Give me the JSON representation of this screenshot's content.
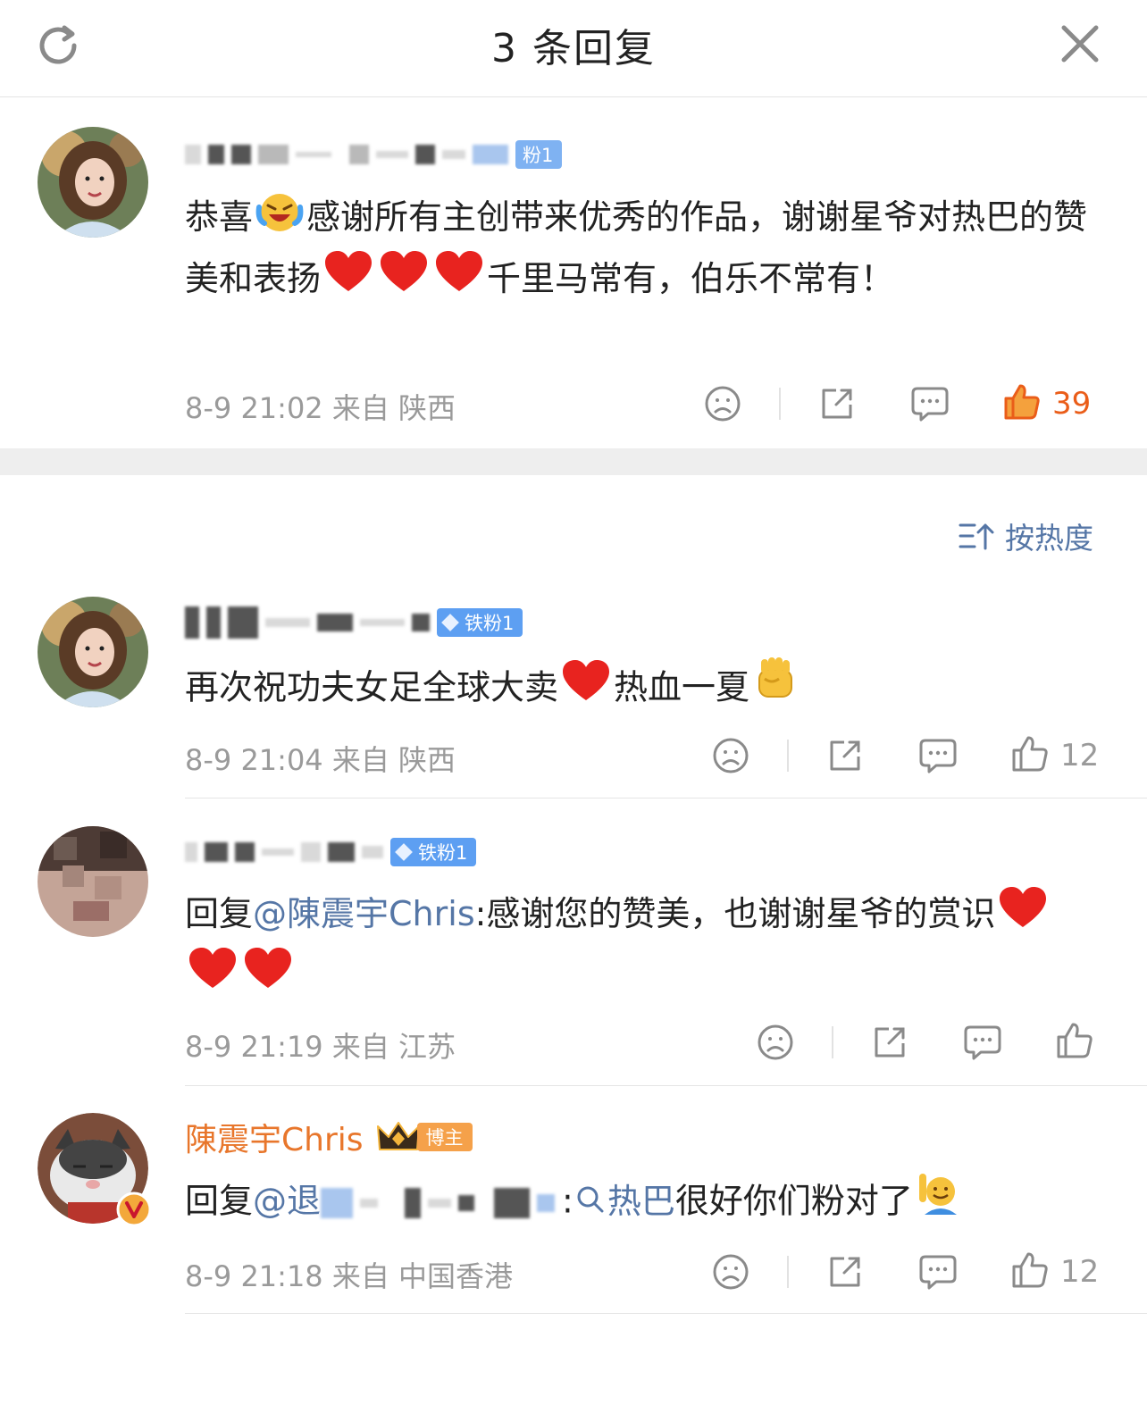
{
  "header": {
    "title": "3 条回复",
    "left_icon": "refresh-icon",
    "right_icon": "close-icon"
  },
  "sort": {
    "label": "按热度",
    "icon": "sort-icon"
  },
  "root_comment": {
    "badge": "粉1",
    "text_before": "恭喜",
    "text_mid": "感谢所有主创带来优秀的作品，谢谢星爷对热巴的赞美和表扬",
    "text_after": "千里马常有，伯乐不常有！",
    "meta": "8-9 21:02 来自 陕西",
    "likes": "39"
  },
  "replies": [
    {
      "badge": "铁粉1",
      "text": "再次祝功夫女足全球大卖",
      "text2": "热血一夏",
      "meta": "8-9 21:04 来自 陕西",
      "likes": "12"
    },
    {
      "badge": "铁粉1",
      "prefix": "回复",
      "mention": "@陳震宇Chris",
      "text": ":感谢您的赞美，也谢谢星爷的赏识",
      "meta": "8-9 21:19 来自 江苏",
      "likes": ""
    },
    {
      "name": "陳震宇Chris",
      "badge": "博主",
      "prefix": "回复",
      "mention": "@退",
      "topic": "热巴",
      "text": "很好你们粉对了",
      "meta": "8-9 21:18 来自 中国香港",
      "likes": "12"
    }
  ],
  "colors": {
    "accent": "#ea5d19",
    "link": "#5576a6",
    "muted": "#9a9a9a",
    "heart": "#e8231f"
  }
}
